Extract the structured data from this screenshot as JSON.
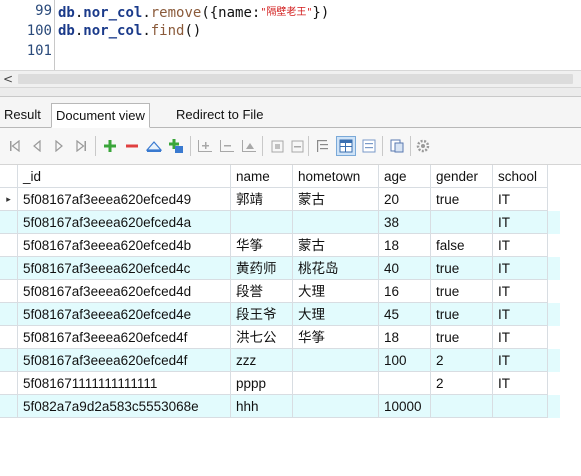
{
  "editor": {
    "lines": [
      {
        "num": "99",
        "obj": "db",
        "dot1": ".",
        "coll": "nor_col",
        "dot2": ".",
        "fn": "remove",
        "open": "({name:",
        "str": "\"隔壁老王\"",
        "close": "})"
      },
      {
        "num": "100",
        "obj": "db",
        "dot1": ".",
        "coll": "nor_col",
        "dot2": ".",
        "fn": "find",
        "open": "()",
        "str": "",
        "close": ""
      },
      {
        "num": "101",
        "obj": "",
        "dot1": "",
        "coll": "",
        "dot2": "",
        "fn": "",
        "open": "",
        "str": "",
        "close": ""
      }
    ]
  },
  "scrollbar": {
    "left_arrow": "<"
  },
  "tabs": [
    {
      "label": "Result"
    },
    {
      "label": "Document view"
    },
    {
      "label": "Redirect to File"
    }
  ],
  "toolbar": {
    "icons": [
      "first-record-icon",
      "prev-record-icon",
      "next-record-icon",
      "last-record-icon",
      "add-record-icon",
      "delete-record-icon",
      "save-record-icon",
      "duplicate-record-icon",
      "insert-row-icon",
      "remove-row-icon",
      "move-row-icon",
      "grid-icon-1",
      "grid-icon-2",
      "text-view-icon",
      "grid-view-icon",
      "form-view-icon",
      "export-icon",
      "settings-icon"
    ],
    "accent_green": "#3aa63a",
    "accent_red": "#e04040",
    "accent_blue": "#3a7ad0"
  },
  "table": {
    "columns": [
      "_id",
      "name",
      "hometown",
      "age",
      "gender",
      "school"
    ],
    "rows": [
      [
        "5f08167af3eeea620efced49",
        "郭靖",
        "蒙古",
        "20",
        "true",
        "IT"
      ],
      [
        "5f08167af3eeea620efced4a",
        "",
        "",
        "38",
        "",
        "IT"
      ],
      [
        "5f08167af3eeea620efced4b",
        "华筝",
        "蒙古",
        "18",
        "false",
        "IT"
      ],
      [
        "5f08167af3eeea620efced4c",
        "黄药师",
        "桃花岛",
        "40",
        "true",
        "IT"
      ],
      [
        "5f08167af3eeea620efced4d",
        "段誉",
        "大理",
        "16",
        "true",
        "IT"
      ],
      [
        "5f08167af3eeea620efced4e",
        "段王爷",
        "大理",
        "45",
        "true",
        "IT"
      ],
      [
        "5f08167af3eeea620efced4f",
        "洪七公",
        "华筝",
        "18",
        "true",
        "IT"
      ],
      [
        "5f08167af3eeea620efced4f",
        "zzz",
        "",
        "100",
        "2",
        "IT"
      ],
      [
        "5f081671111111111111",
        "pppp",
        "",
        "",
        "2",
        "IT"
      ],
      [
        "5f082a7a9d2a583c5553068e",
        "hhh",
        "",
        "10000",
        "",
        ""
      ]
    ],
    "current_row_marker": "▸",
    "odd_row_color": "#e2fbfd"
  }
}
